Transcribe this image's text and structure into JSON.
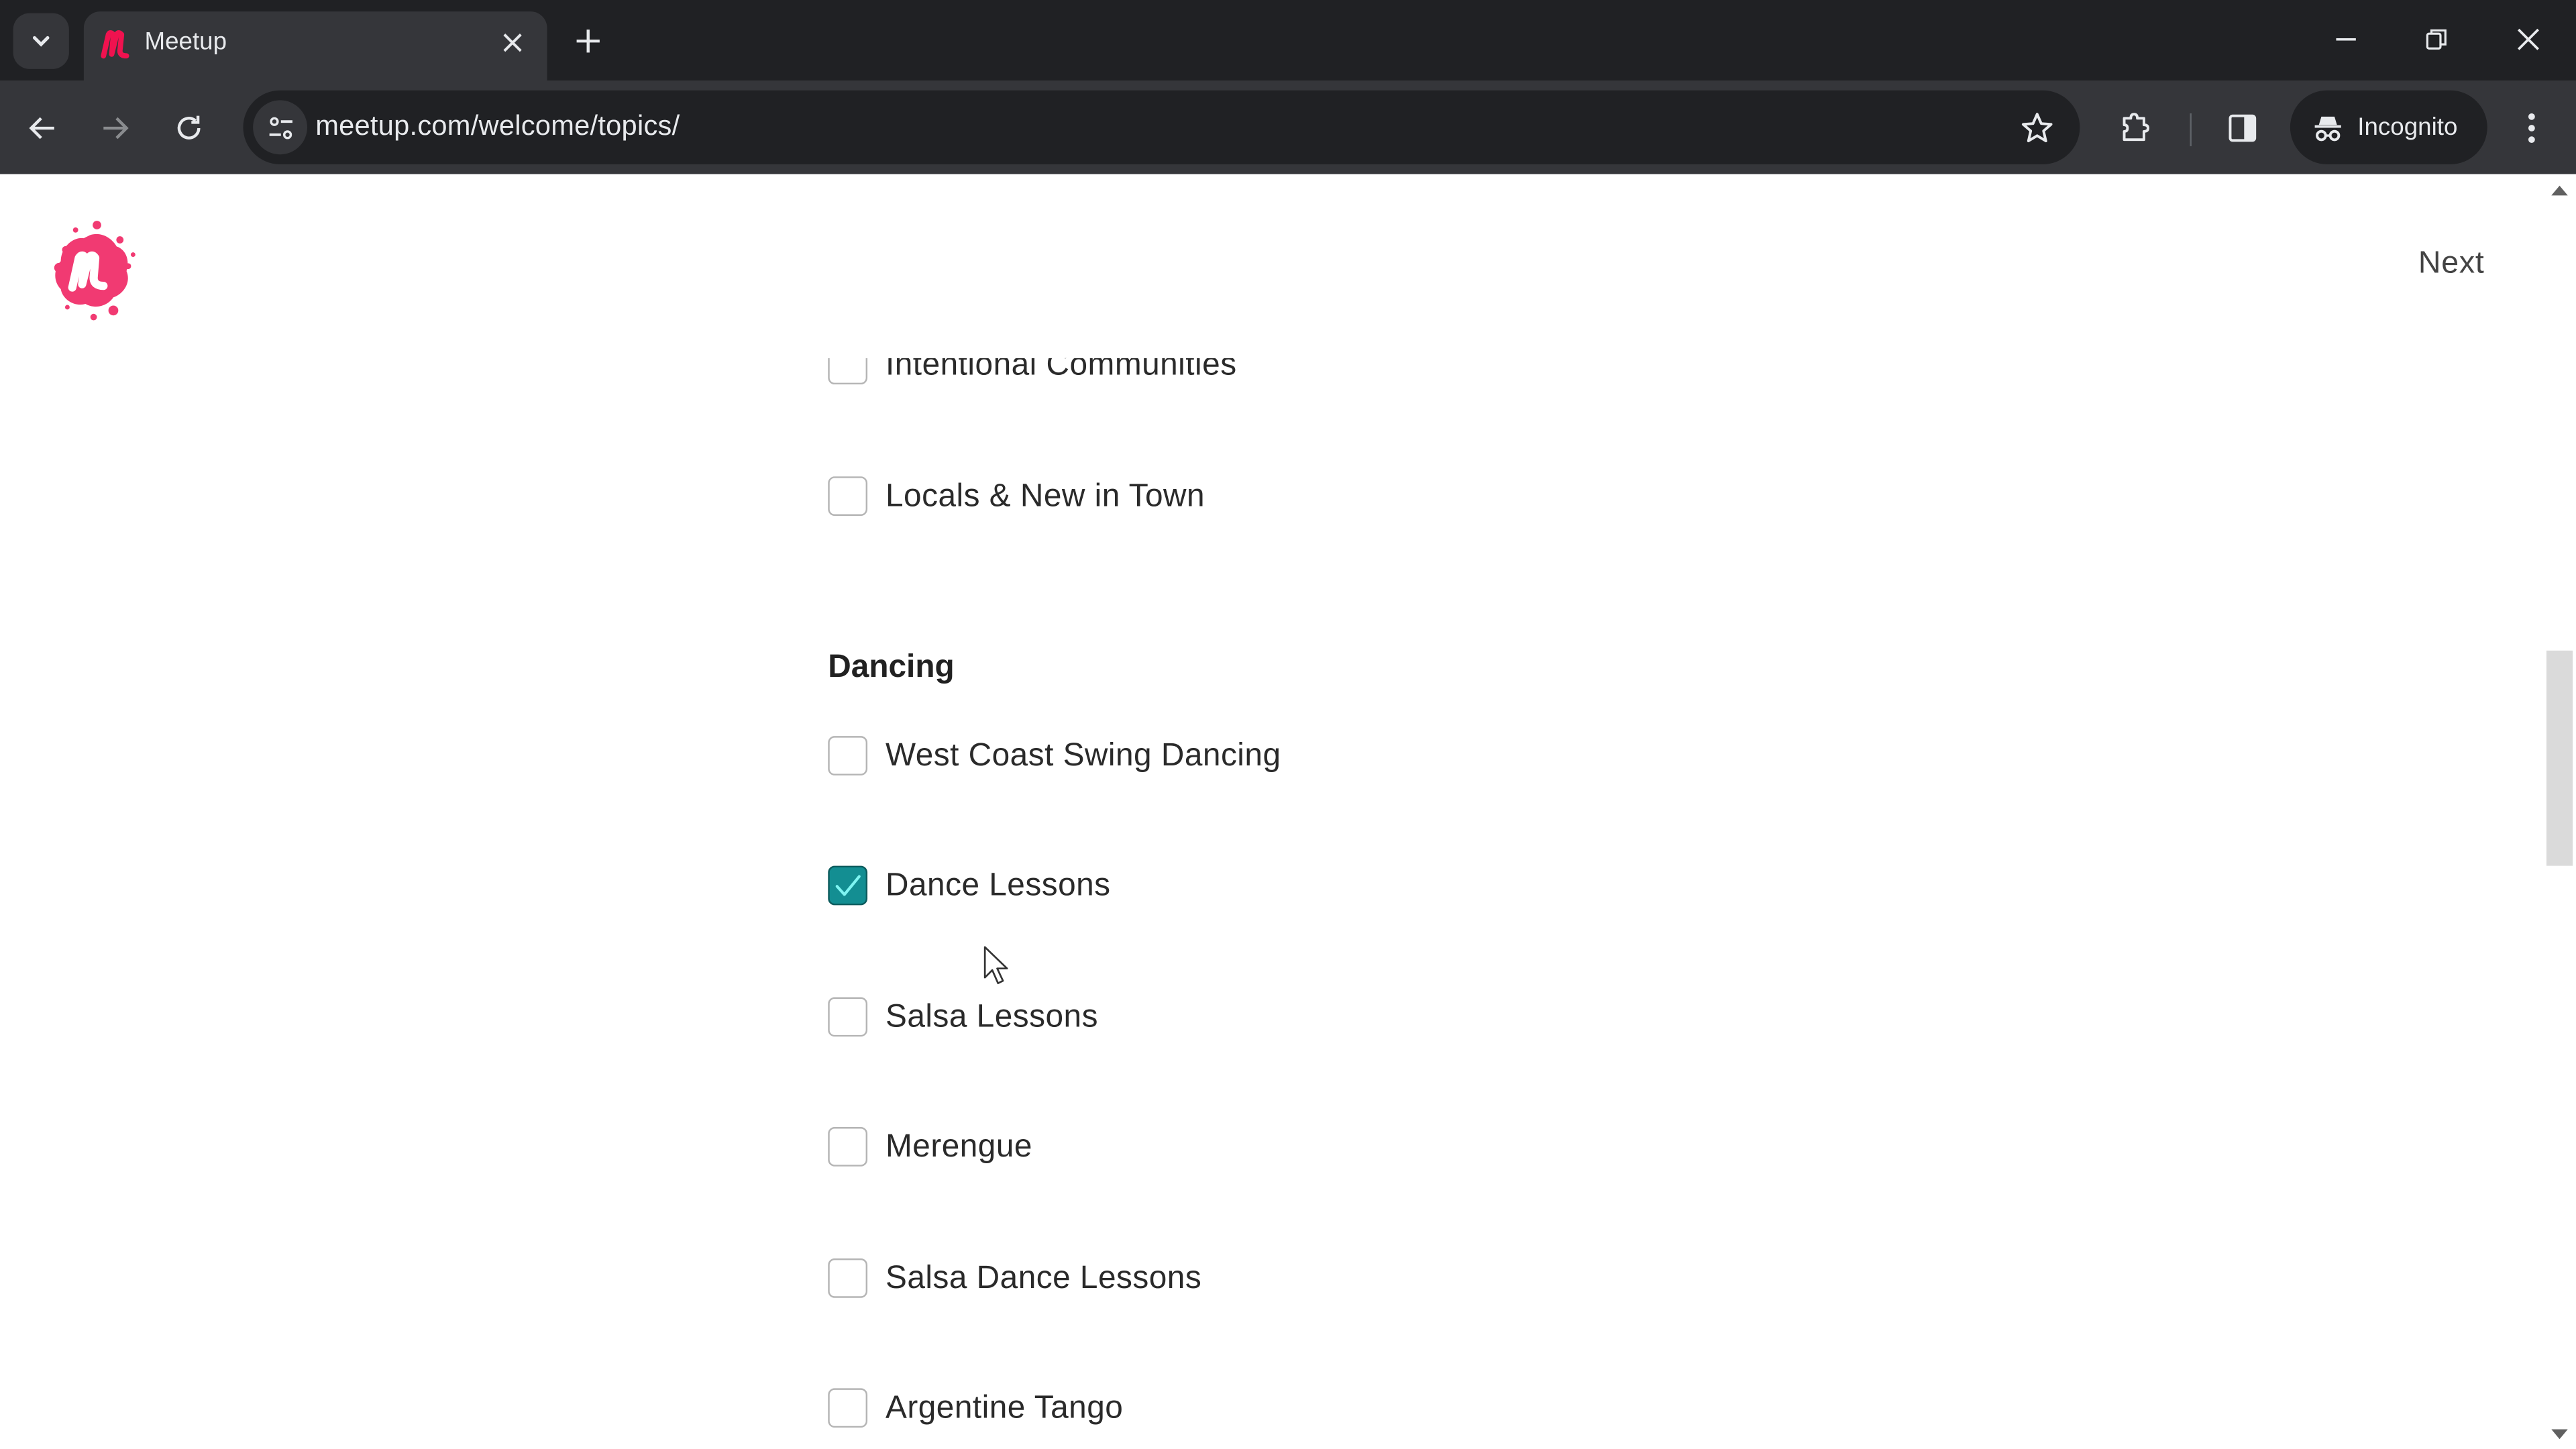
{
  "browser": {
    "tab": {
      "title": "Meetup",
      "favicon": "meetup-m-icon"
    },
    "url": "meetup.com/welcome/topics/",
    "profile_label": "Incognito",
    "icons": {
      "tab_search": "chevron-down-icon",
      "tab_close": "close-icon",
      "new_tab": "plus-icon",
      "minimize": "minimize-icon",
      "restore": "restore-icon",
      "close_window": "close-icon",
      "back": "arrow-left-icon",
      "forward": "arrow-right-icon",
      "reload": "reload-icon",
      "site_info": "tune-icon",
      "bookmark": "star-icon",
      "extensions": "puzzle-icon",
      "side_panel": "side-panel-icon",
      "incognito": "incognito-icon",
      "menu": "kebab-menu-icon"
    }
  },
  "page": {
    "header": {
      "logo": "meetup-logo",
      "next_label": "Next"
    },
    "topics_above": [
      {
        "label": "Intentional Communities",
        "checked": false
      },
      {
        "label": "Locals & New in Town",
        "checked": false
      }
    ],
    "section": {
      "title": "Dancing",
      "items": [
        {
          "label": "West Coast Swing Dancing",
          "checked": false
        },
        {
          "label": "Dance Lessons",
          "checked": true
        },
        {
          "label": "Salsa Lessons",
          "checked": false
        },
        {
          "label": "Merengue",
          "checked": false
        },
        {
          "label": "Salsa Dance Lessons",
          "checked": false
        },
        {
          "label": "Argentine Tango",
          "checked": false
        }
      ]
    },
    "colors": {
      "brand": "#f13a72",
      "checkbox_checked": "#138e92",
      "checkmark": "#7ff5f2"
    }
  }
}
